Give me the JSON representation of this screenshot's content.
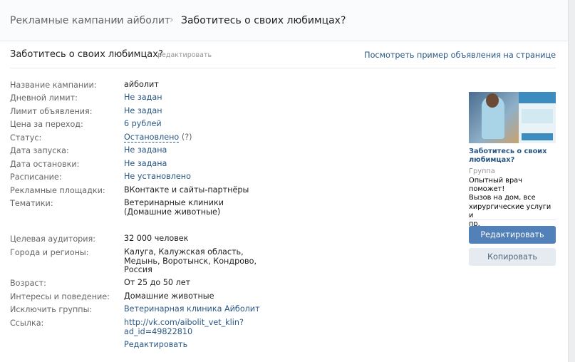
{
  "breadcrumb": {
    "items": [
      "Рекламные кампании",
      "айболит",
      "Заботитесь о своих любимцах?"
    ],
    "separator": "›"
  },
  "header": {
    "title": "Заботитесь о своих любимцах?",
    "edit_label": "редактировать",
    "preview_link": "Посмотреть пример объявления на странице"
  },
  "details": {
    "campaign_name": {
      "label": "Название кампании:",
      "value": "айболит"
    },
    "daily_limit": {
      "label": "Дневной лимит:",
      "value": "Не задан"
    },
    "ad_limit": {
      "label": "Лимит объявления:",
      "value": "Не задан"
    },
    "click_price": {
      "label": "Цена за переход:",
      "value": "6 рублей"
    },
    "status": {
      "label": "Статус:",
      "value": "Остановлено",
      "hint": "(?)"
    },
    "start_date": {
      "label": "Дата запуска:",
      "value": "Не задана"
    },
    "stop_date": {
      "label": "Дата остановки:",
      "value": "Не задана"
    },
    "schedule": {
      "label": "Расписание:",
      "value": "Не установлено"
    },
    "platforms": {
      "label": "Рекламные площадки:",
      "value": "ВКонтакте и сайты-партнёры"
    },
    "topics": {
      "label": "Тематики:",
      "value_line1": "Ветеринарные клиники",
      "value_line2": "(Домашние животные)"
    },
    "audience": {
      "label": "Целевая аудитория:",
      "value": "32 000 человек"
    },
    "regions": {
      "label": "Города и регионы:",
      "value_line1": "Калуга, Калужская область,",
      "value_line2": "Медынь, Воротынск, Кондрово,",
      "value_line3": "Россия"
    },
    "age": {
      "label": "Возраст:",
      "value": "От 25 до 50 лет"
    },
    "interests": {
      "label": "Интересы и поведение:",
      "value": "Домашние животные"
    },
    "exclude_groups": {
      "label": "Исключить группы:",
      "value": "Ветеринарная клиника Айболит"
    },
    "link": {
      "label": "Ссылка:",
      "value_line1": "http://vk.com/aibolit_vet_klin?",
      "value_line2": "ad_id=49822810"
    },
    "edit_link": "Редактировать"
  },
  "ad_preview": {
    "title_line1": "Заботитесь о своих",
    "title_line2": "любимцах?",
    "type": "Группа",
    "desc_line1": "Опытный врач поможет!",
    "desc_line2": "Вызов на дом, все",
    "desc_line3": "хирургические услуги и",
    "desc_line4": "пр."
  },
  "buttons": {
    "edit": "Редактировать",
    "copy": "Копировать"
  },
  "colors": {
    "link": "#2a5885",
    "primary_button": "#5181b8",
    "secondary_button": "#e5ebf1"
  }
}
